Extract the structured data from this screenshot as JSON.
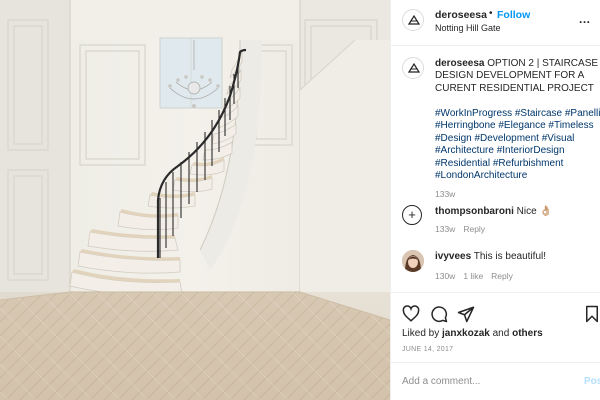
{
  "post": {
    "username": "deroseesa",
    "separator": "•",
    "follow_label": "Follow",
    "location": "Notting Hill Gate",
    "more_label": "...",
    "caption_username": "deroseesa",
    "caption_lines": [
      "OPTION 2 | STAIRCASE",
      "DESIGN DEVELOPMENT FOR A",
      "CURENT RESIDENTIAL PROJECT"
    ],
    "hashtag_lines": [
      "#WorkInProgress #Staircase #Panelling",
      "#Herringbone #Elegance #Timeless",
      "#Design #Development #Visual",
      "#Architecture #InteriorDesign",
      "#Residential #Refurbishment",
      "#LondonArchitecture"
    ],
    "caption_time": "133w"
  },
  "comments": [
    {
      "username": "thompsonbaroni",
      "text": "Nice 👌🏼",
      "time": "133w",
      "likes": "",
      "reply_label": "Reply"
    },
    {
      "username": "ivyvees",
      "text": "This is beautiful!",
      "time": "130w",
      "likes": "1 like",
      "reply_label": "Reply"
    }
  ],
  "actions": {
    "liked_by_prefix": "Liked by",
    "liked_by_user": "janxkozak",
    "liked_by_and": "and",
    "liked_by_others": "others",
    "date": "JUNE 14, 2017"
  },
  "comment_box": {
    "placeholder": "Add a comment...",
    "post_label": "Post"
  },
  "colors": {
    "link_blue": "#0095f6",
    "hashtag_blue": "#00376b",
    "muted_gray": "#8e8e8e",
    "post_disabled": "#b2dffc"
  },
  "icons": {
    "more": "ellipsis-icon",
    "add_comment": "plus-circle-icon",
    "like": "heart-icon",
    "comment": "comment-bubble-icon",
    "share": "paper-plane-icon",
    "save": "bookmark-icon"
  }
}
